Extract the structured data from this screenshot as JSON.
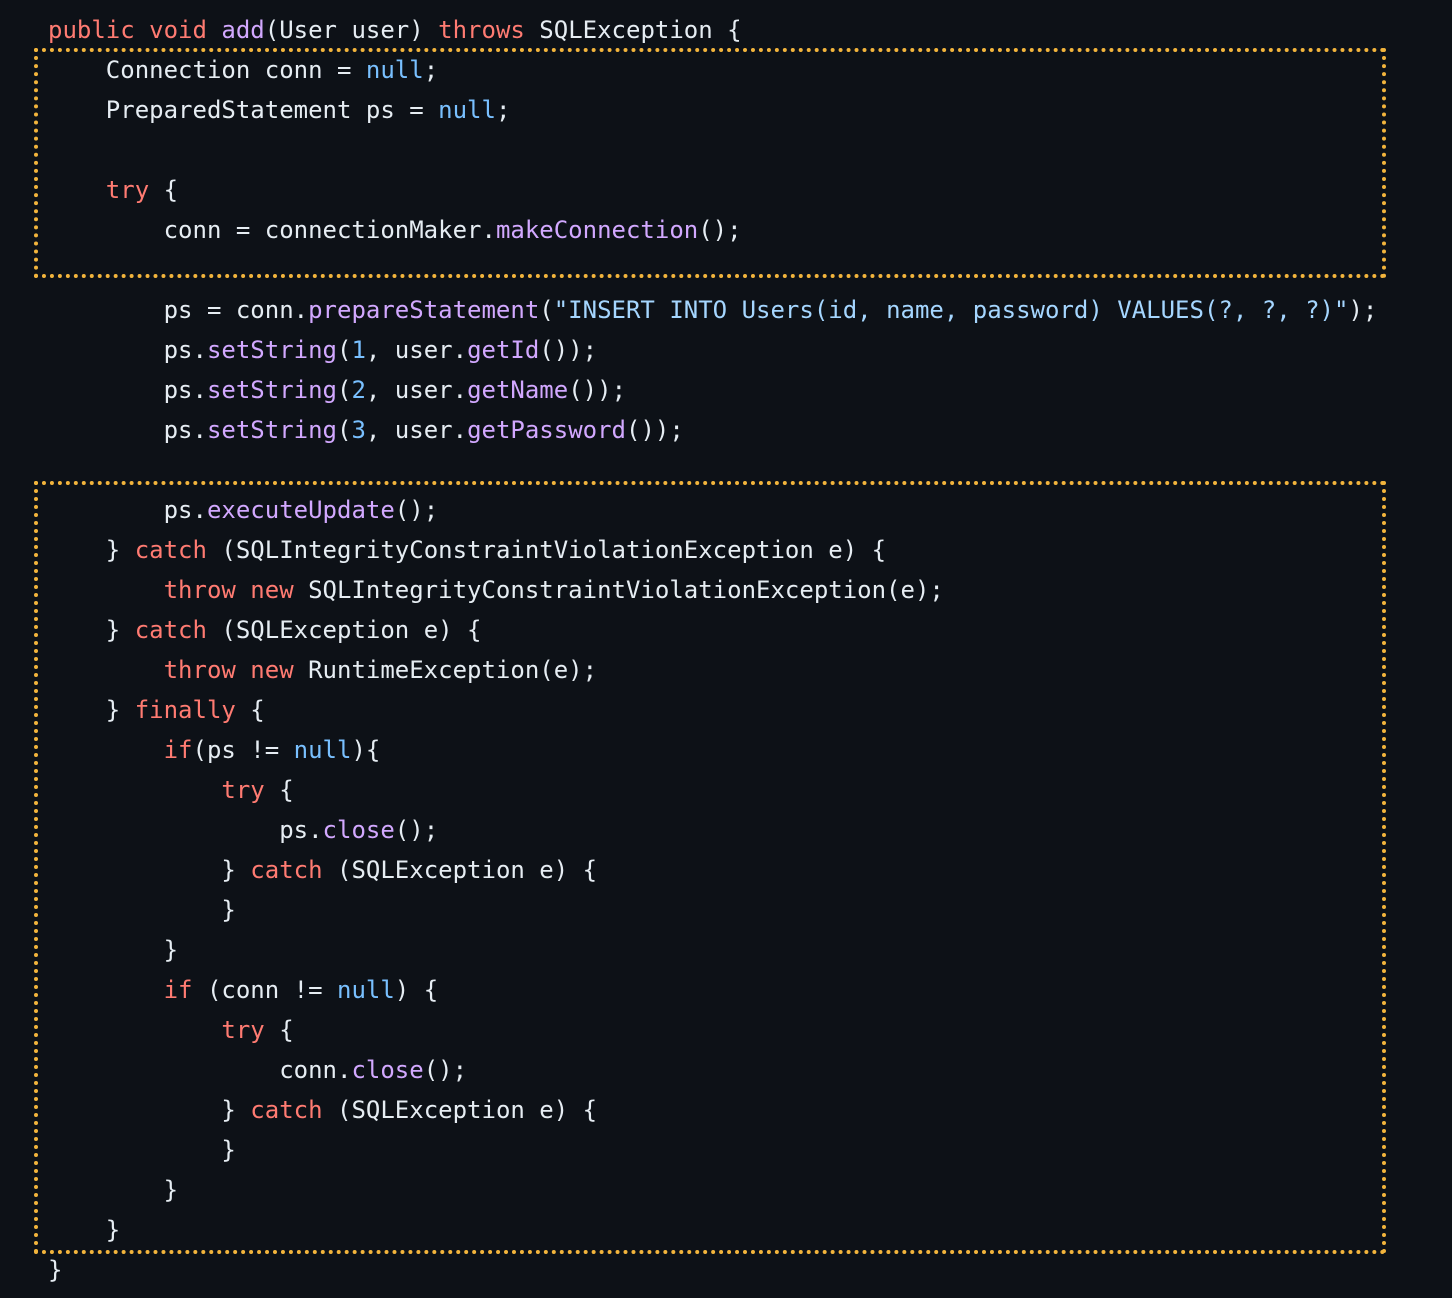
{
  "code_lines": [
    [
      {
        "t": "public void ",
        "c": "kw"
      },
      {
        "t": "add",
        "c": "fn"
      },
      {
        "t": "(User user) ",
        "c": "plain"
      },
      {
        "t": "throws",
        "c": "kw"
      },
      {
        "t": " SQLException {",
        "c": "plain"
      }
    ],
    [
      {
        "t": "    Connection conn = ",
        "c": "plain"
      },
      {
        "t": "null",
        "c": "lit"
      },
      {
        "t": ";",
        "c": "plain"
      }
    ],
    [
      {
        "t": "    PreparedStatement ps = ",
        "c": "plain"
      },
      {
        "t": "null",
        "c": "lit"
      },
      {
        "t": ";",
        "c": "plain"
      }
    ],
    [
      {
        "t": "",
        "c": "plain"
      }
    ],
    [
      {
        "t": "    ",
        "c": "plain"
      },
      {
        "t": "try",
        "c": "kw"
      },
      {
        "t": " {",
        "c": "plain"
      }
    ],
    [
      {
        "t": "        conn = connectionMaker.",
        "c": "plain"
      },
      {
        "t": "makeConnection",
        "c": "fn"
      },
      {
        "t": "();",
        "c": "plain"
      }
    ],
    [
      {
        "t": "",
        "c": "plain"
      }
    ],
    [
      {
        "t": "        ps = conn.",
        "c": "plain"
      },
      {
        "t": "prepareStatement",
        "c": "fn"
      },
      {
        "t": "(",
        "c": "plain"
      },
      {
        "t": "\"INSERT INTO Users(id, name, password) VALUES(?, ?, ?)\"",
        "c": "str"
      },
      {
        "t": ");",
        "c": "plain"
      }
    ],
    [
      {
        "t": "        ps.",
        "c": "plain"
      },
      {
        "t": "setString",
        "c": "fn"
      },
      {
        "t": "(",
        "c": "plain"
      },
      {
        "t": "1",
        "c": "lit"
      },
      {
        "t": ", user.",
        "c": "plain"
      },
      {
        "t": "getId",
        "c": "fn"
      },
      {
        "t": "());",
        "c": "plain"
      }
    ],
    [
      {
        "t": "        ps.",
        "c": "plain"
      },
      {
        "t": "setString",
        "c": "fn"
      },
      {
        "t": "(",
        "c": "plain"
      },
      {
        "t": "2",
        "c": "lit"
      },
      {
        "t": ", user.",
        "c": "plain"
      },
      {
        "t": "getName",
        "c": "fn"
      },
      {
        "t": "());",
        "c": "plain"
      }
    ],
    [
      {
        "t": "        ps.",
        "c": "plain"
      },
      {
        "t": "setString",
        "c": "fn"
      },
      {
        "t": "(",
        "c": "plain"
      },
      {
        "t": "3",
        "c": "lit"
      },
      {
        "t": ", user.",
        "c": "plain"
      },
      {
        "t": "getPassword",
        "c": "fn"
      },
      {
        "t": "());",
        "c": "plain"
      }
    ],
    [
      {
        "t": "",
        "c": "plain"
      }
    ],
    [
      {
        "t": "        ps.",
        "c": "plain"
      },
      {
        "t": "executeUpdate",
        "c": "fn"
      },
      {
        "t": "();",
        "c": "plain"
      }
    ],
    [
      {
        "t": "    } ",
        "c": "plain"
      },
      {
        "t": "catch",
        "c": "kw"
      },
      {
        "t": " (SQLIntegrityConstraintViolationException e) {",
        "c": "plain"
      }
    ],
    [
      {
        "t": "        ",
        "c": "plain"
      },
      {
        "t": "throw new",
        "c": "kw"
      },
      {
        "t": " SQLIntegrityConstraintViolationException(e);",
        "c": "plain"
      }
    ],
    [
      {
        "t": "    } ",
        "c": "plain"
      },
      {
        "t": "catch",
        "c": "kw"
      },
      {
        "t": " (SQLException e) {",
        "c": "plain"
      }
    ],
    [
      {
        "t": "        ",
        "c": "plain"
      },
      {
        "t": "throw new",
        "c": "kw"
      },
      {
        "t": " RuntimeException(e);",
        "c": "plain"
      }
    ],
    [
      {
        "t": "    } ",
        "c": "plain"
      },
      {
        "t": "finally",
        "c": "kw"
      },
      {
        "t": " {",
        "c": "plain"
      }
    ],
    [
      {
        "t": "        ",
        "c": "plain"
      },
      {
        "t": "if",
        "c": "kw"
      },
      {
        "t": "(ps != ",
        "c": "plain"
      },
      {
        "t": "null",
        "c": "lit"
      },
      {
        "t": "){",
        "c": "plain"
      }
    ],
    [
      {
        "t": "            ",
        "c": "plain"
      },
      {
        "t": "try",
        "c": "kw"
      },
      {
        "t": " {",
        "c": "plain"
      }
    ],
    [
      {
        "t": "                ps.",
        "c": "plain"
      },
      {
        "t": "close",
        "c": "fn"
      },
      {
        "t": "();",
        "c": "plain"
      }
    ],
    [
      {
        "t": "            } ",
        "c": "plain"
      },
      {
        "t": "catch",
        "c": "kw"
      },
      {
        "t": " (SQLException e) {",
        "c": "plain"
      }
    ],
    [
      {
        "t": "            }",
        "c": "plain"
      }
    ],
    [
      {
        "t": "        }",
        "c": "plain"
      }
    ],
    [
      {
        "t": "        ",
        "c": "plain"
      },
      {
        "t": "if",
        "c": "kw"
      },
      {
        "t": " (conn != ",
        "c": "plain"
      },
      {
        "t": "null",
        "c": "lit"
      },
      {
        "t": ") {",
        "c": "plain"
      }
    ],
    [
      {
        "t": "            ",
        "c": "plain"
      },
      {
        "t": "try",
        "c": "kw"
      },
      {
        "t": " {",
        "c": "plain"
      }
    ],
    [
      {
        "t": "                conn.",
        "c": "plain"
      },
      {
        "t": "close",
        "c": "fn"
      },
      {
        "t": "();",
        "c": "plain"
      }
    ],
    [
      {
        "t": "            } ",
        "c": "plain"
      },
      {
        "t": "catch",
        "c": "kw"
      },
      {
        "t": " (SQLException e) {",
        "c": "plain"
      }
    ],
    [
      {
        "t": "            }",
        "c": "plain"
      }
    ],
    [
      {
        "t": "        }",
        "c": "plain"
      }
    ],
    [
      {
        "t": "    }",
        "c": "plain"
      }
    ],
    [
      {
        "t": "}",
        "c": "plain"
      }
    ]
  ],
  "colors": {
    "background": "#0d1117",
    "text": "#e6edf3",
    "keyword": "#ff7b72",
    "function": "#d2a8ff",
    "literal": "#79c0ff",
    "string": "#a5d6ff",
    "highlight_border": "#f2b43c"
  }
}
